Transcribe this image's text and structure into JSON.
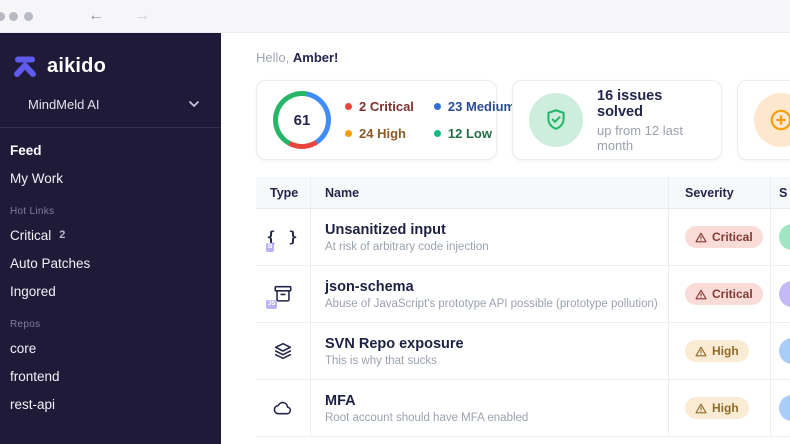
{
  "window": {
    "back_label": "←",
    "forward_label": "→"
  },
  "colors": {
    "accent_purple": "#5e5bef",
    "sidebar_bg": "#1e1a38",
    "critical_red": "#e8453c",
    "high_orange": "#f59e0b",
    "medium_blue": "#2f6fd6",
    "low_green": "#27b567"
  },
  "sidebar": {
    "logo_text": "aikido",
    "workspace_name": "MindMeld AI",
    "nav_items": [
      {
        "label": "Feed"
      },
      {
        "label": "My Work"
      }
    ],
    "sections": [
      {
        "title": "Hot Links",
        "items": [
          {
            "label": "Critical",
            "badge": "2"
          },
          {
            "label": "Auto Patches"
          },
          {
            "label": "Ingored"
          }
        ]
      },
      {
        "title": "Repos",
        "items": [
          {
            "label": "core"
          },
          {
            "label": "frontend"
          },
          {
            "label": "rest-api"
          }
        ]
      }
    ]
  },
  "main": {
    "greeting_prefix": "Hello,",
    "greeting_name": "Amber!",
    "score_card": {
      "score": "61",
      "legend": [
        {
          "label": "2 Critical",
          "dot": "#e8453c",
          "text": "#7d322e"
        },
        {
          "label": "24 High",
          "dot": "#f59e0b",
          "text": "#8a5a28"
        },
        {
          "label": "23 Medium",
          "dot": "#2f6fd6",
          "text": "#2a4d8f"
        },
        {
          "label": "12 Low",
          "dot": "#10b981",
          "text": "#226e46"
        }
      ]
    },
    "solved_card": {
      "title": "16 issues solved",
      "subtitle": "up from 12 last month"
    },
    "table": {
      "headers": [
        "Type",
        "Name",
        "Severity",
        "S"
      ],
      "rows": [
        {
          "icon": "code-braces-icon",
          "badge": "B",
          "name": "Unsanitized input",
          "description": "At risk of arbitrary code injection",
          "severity": "Critical",
          "status_color": "#9fe6c3"
        },
        {
          "icon": "package-icon",
          "badge": "JS",
          "name": "json-schema",
          "description": "Abuse of JavaScript's prototype API possible (prototype pollution)",
          "severity": "Critical",
          "status_color": "#c5baf7"
        },
        {
          "icon": "layers-icon",
          "name": "SVN Repo exposure",
          "description": "This is why that sucks",
          "severity": "High",
          "status_color": "#a8cef8"
        },
        {
          "icon": "cloud-icon",
          "name": "MFA",
          "description": "Root account should have MFA enabled",
          "severity": "High",
          "status_color": "#a8cef8"
        }
      ]
    }
  }
}
